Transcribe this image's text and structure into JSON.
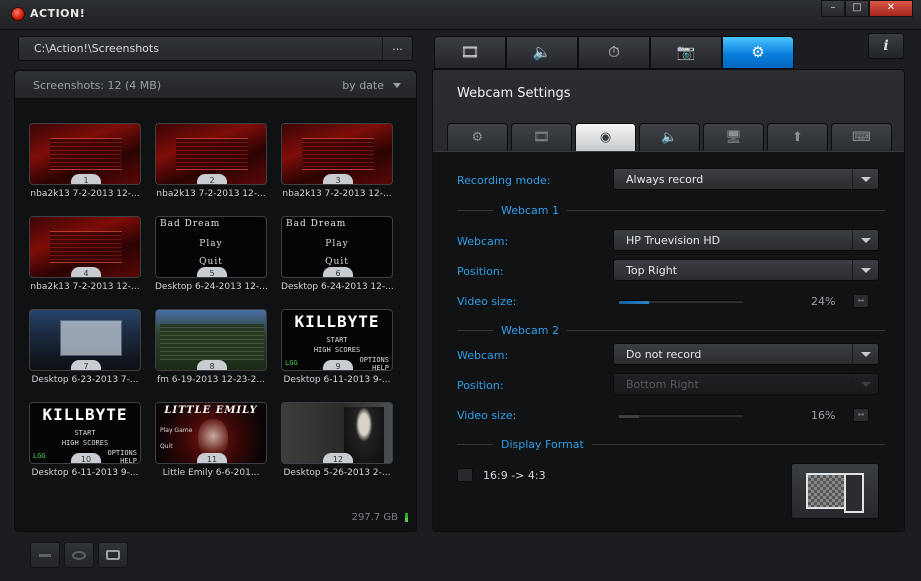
{
  "app": {
    "title": "ACTION!",
    "window_buttons": [
      "–",
      "□",
      "✕"
    ],
    "info_label": "i"
  },
  "path": {
    "value": "C:\\Action!\\Screenshots",
    "browse_label": "..."
  },
  "screenshots": {
    "count_label": "Screenshots: 12 (4 MB)",
    "sort_label": "by date",
    "disk_free": "297.7 GB",
    "items": [
      {
        "num": "1",
        "caption": "nba2k13 7-2-2013 12-...",
        "style": "red"
      },
      {
        "num": "2",
        "caption": "nba2k13 7-2-2013 12-...",
        "style": "red"
      },
      {
        "num": "3",
        "caption": "nba2k13 7-2-2013 12-...",
        "style": "red"
      },
      {
        "num": "4",
        "caption": "nba2k13 7-2-2013 12-...",
        "style": "red"
      },
      {
        "num": "5",
        "caption": "Desktop 6-24-2013 12-...",
        "style": "dark",
        "title": "Bad Dream",
        "line1": "Play",
        "line2": "Quit"
      },
      {
        "num": "6",
        "caption": "Desktop 6-24-2013 12-...",
        "style": "dark",
        "title": "Bad Dream",
        "line1": "Play",
        "line2": "Quit"
      },
      {
        "num": "7",
        "caption": "Desktop 6-23-2013 7-...",
        "style": "desk"
      },
      {
        "num": "8",
        "caption": "fm 6-19-2013 12-23-2...",
        "style": "fm"
      },
      {
        "num": "9",
        "caption": "Desktop 6-11-2013 9-...",
        "style": "killbyte",
        "title": "KILLBYTE",
        "line1": "START",
        "line2": "HIGH SCORES",
        "corner1": "OPTIONS",
        "corner2": "HELP",
        "tag": "LGG"
      },
      {
        "num": "10",
        "caption": "Desktop 6-11-2013 9-...",
        "style": "killbyte",
        "title": "KILLBYTE",
        "line1": "START",
        "line2": "HIGH SCORES",
        "corner1": "OPTIONS",
        "corner2": "HELP",
        "tag": "LGG"
      },
      {
        "num": "11",
        "caption": "Little Emily 6-6-201...",
        "style": "emily",
        "title": "LITTLE EMILY",
        "line1": "Play Game",
        "line2": "Quit"
      },
      {
        "num": "12",
        "caption": "Desktop 5-26-2013 2-...",
        "style": "football"
      }
    ]
  },
  "main_tabs": [
    {
      "name": "video",
      "icon": "film-icon",
      "glyph": "🎞"
    },
    {
      "name": "audio",
      "icon": "speaker-icon",
      "glyph": "🔈"
    },
    {
      "name": "benchmark",
      "icon": "stopwatch-icon",
      "glyph": "⏱"
    },
    {
      "name": "screenshots",
      "icon": "camera-icon",
      "glyph": "📷"
    },
    {
      "name": "settings",
      "icon": "gear-icon",
      "glyph": "⚙",
      "active": true
    }
  ],
  "settings": {
    "title": "Webcam Settings",
    "sub_tabs": [
      {
        "name": "general",
        "icon": "gear-icon",
        "glyph": "⚙"
      },
      {
        "name": "video",
        "icon": "film-icon",
        "glyph": "🎞"
      },
      {
        "name": "webcam",
        "icon": "webcam-icon",
        "glyph": "◉",
        "active": true
      },
      {
        "name": "audio",
        "icon": "speaker-icon",
        "glyph": "🔈"
      },
      {
        "name": "display",
        "icon": "monitor-icon",
        "glyph": "🖥"
      },
      {
        "name": "upload",
        "icon": "upload-icon",
        "glyph": "⬆"
      },
      {
        "name": "hotkeys",
        "icon": "keyboard-icon",
        "glyph": "⌨"
      }
    ],
    "recording_mode": {
      "label": "Recording mode:",
      "value": "Always record"
    },
    "webcam1": {
      "section": "Webcam 1",
      "webcam_label": "Webcam:",
      "webcam_value": "HP Truevision HD",
      "position_label": "Position:",
      "position_value": "Top Right",
      "size_label": "Video size:",
      "size_pct": "24%",
      "size_value": 0.24
    },
    "webcam2": {
      "section": "Webcam 2",
      "webcam_label": "Webcam:",
      "webcam_value": "Do not record",
      "position_label": "Position:",
      "position_value": "Bottom Right",
      "size_label": "Video size:",
      "size_pct": "16%",
      "size_value": 0.16
    },
    "display_format": {
      "section": "Display Format",
      "option_label": "16:9 -> 4:3"
    },
    "expand_glyph": "↔"
  },
  "colors": {
    "accent_blue": "#0a7fdc",
    "label_blue": "#2f9fe6",
    "close_red": "#c0392b"
  }
}
